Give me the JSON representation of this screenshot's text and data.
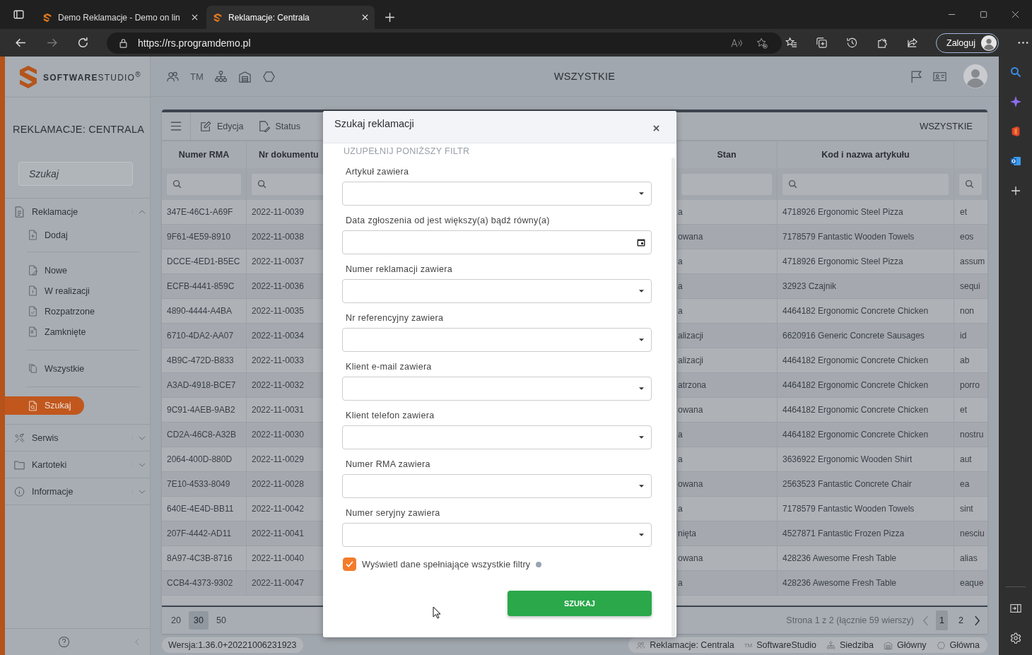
{
  "browser": {
    "tabs": [
      {
        "title": "Demo Reklamacje - Demo on lin",
        "selected": false
      },
      {
        "title": "Reklamacje: Centrala",
        "selected": true
      }
    ],
    "url": "https://rs.programdemo.pl",
    "forward_disabled": true,
    "sign_in": "Zaloguj"
  },
  "header": {
    "logo": "**SOFTWARE**STUDIO$^{®}$",
    "tm": "TM",
    "title": "WSZYSTKIE"
  },
  "sidebar": {
    "title": "REKLAMACJE: CENTRALA",
    "search": {
      "placeholder": "Szukaj"
    },
    "groups": [
      {
        "label": "Reklamacje",
        "expanded": true,
        "sections": [
          {
            "items": [
              {
                "label": "Dodaj",
                "selected": false
              }
            ]
          },
          {
            "items": [
              {
                "label": "Nowe",
                "selected": false
              },
              {
                "label": "W realizacji",
                "selected": false
              },
              {
                "label": "Rozpatrzone",
                "selected": false
              },
              {
                "label": "Zamknięte",
                "selected": false
              }
            ]
          },
          {
            "items": [
              {
                "label": "Wszystkie",
                "selected": false
              }
            ]
          },
          {
            "items": [
              {
                "label": "Szukaj",
                "selected": true
              }
            ]
          }
        ]
      },
      {
        "label": "Serwis",
        "expanded": false
      },
      {
        "label": "Kartoteki",
        "expanded": false
      },
      {
        "label": "Informacje",
        "expanded": false
      }
    ]
  },
  "table": {
    "actions": [
      "Edycja",
      "Status"
    ],
    "view": "WSZYSTKIE",
    "columns": [
      "Numer RMA",
      "Nr dokumentu",
      "Stan",
      "Kod i nazwa artykułu"
    ],
    "rows": [
      {
        "rma": "347E-46C1-A69F",
        "document": "2022-11-0039",
        "status": "a",
        "article": "4718926 Ergonomic Steel Pizza",
        "column_5": "et"
      },
      {
        "rma": "9F61-4E59-8910",
        "document": "2022-11-0038",
        "status": "owana",
        "article": "7178579 Fantastic Wooden Towels",
        "column_5": "eos"
      },
      {
        "rma": "DCCE-4ED1-B5EC",
        "document": "2022-11-0037",
        "status": "a",
        "article": "4718926 Ergonomic Steel Pizza",
        "column_5": "assum"
      },
      {
        "rma": "ECFB-4441-859C",
        "document": "2022-11-0036",
        "status": "a",
        "article": "32923 Czajnik",
        "column_5": "sequi"
      },
      {
        "rma": "4890-4444-A4BA",
        "document": "2022-11-0035",
        "status": "a",
        "article": "4464182 Ergonomic Concrete Chicken",
        "column_5": "non"
      },
      {
        "rma": "6710-4DA2-AA07",
        "document": "2022-11-0034",
        "status": "alizacji",
        "article": "6620916 Generic Concrete Sausages",
        "column_5": "id"
      },
      {
        "rma": "4B9C-472D-B833",
        "document": "2022-11-0033",
        "status": "alizacji",
        "article": "4464182 Ergonomic Concrete Chicken",
        "column_5": "ab"
      },
      {
        "rma": "A3AD-4918-BCE7",
        "document": "2022-11-0032",
        "status": "atrzona",
        "article": "4464182 Ergonomic Concrete Chicken",
        "column_5": "porro"
      },
      {
        "rma": "9C91-4AEB-9AB2",
        "document": "2022-11-0031",
        "status": "owana",
        "article": "4464182 Ergonomic Concrete Chicken",
        "column_5": "et"
      },
      {
        "rma": "CD2A-46C8-A32B",
        "document": "2022-11-0030",
        "status": "a",
        "article": "4464182 Ergonomic Concrete Chicken",
        "column_5": "nostru"
      },
      {
        "rma": "2064-400D-880D",
        "document": "2022-11-0029",
        "status": "a",
        "article": "3636922 Ergonomic Wooden Shirt",
        "column_5": "aut"
      },
      {
        "rma": "7E10-4533-8049",
        "document": "2022-11-0028",
        "status": "owana",
        "article": "2563523 Fantastic Concrete Chair",
        "column_5": "ea"
      },
      {
        "rma": "640E-4E4D-BB11",
        "document": "2022-11-0042",
        "status": "a",
        "article": "7178579 Fantastic Wooden Towels",
        "column_5": "sint"
      },
      {
        "rma": "207F-4442-AD11",
        "document": "2022-11-0041",
        "status": "nięta",
        "article": "4527871 Fantastic Frozen Pizza",
        "column_5": "nesciu"
      },
      {
        "rma": "8A97-4C3B-8716",
        "document": "2022-11-0040",
        "status": "owana",
        "article": "428236 Awesome Fresh Table",
        "column_5": "alias"
      },
      {
        "rma": "CCB4-4373-9302",
        "document": "2022-11-0047",
        "status": "a",
        "article": "428236 Awesome Fresh Table",
        "column_5": "eaque"
      }
    ],
    "page_sizes": [
      {
        "label": "20",
        "selected": false
      },
      {
        "label": "30",
        "selected": true
      },
      {
        "label": "50",
        "selected": false
      }
    ],
    "page_info": "Strona 1 z 2 (łącznie 59 wierszy)",
    "pages": [
      {
        "label": "1",
        "selected": true
      },
      {
        "label": "2",
        "selected": false
      }
    ]
  },
  "status_bar": {
    "version": "Wersja:1.36.0+20221006231923",
    "context": [
      {
        "label": "Reklamacje: Centrala"
      },
      {
        "mark": "TM",
        "label": "SoftwareStudio"
      },
      {
        "label": "Siedziba"
      },
      {
        "label": "Główny"
      },
      {
        "label": "Główna"
      }
    ]
  },
  "dialog": {
    "title": "Szukaj reklamacji",
    "section": "UZUPEŁNIJ PONIŻSZY FILTR",
    "fields": [
      {
        "label": "Artykuł zawiera",
        "kind": "dropdown"
      },
      {
        "label": "Data zgłoszenia od jest większy(a) bądź równy(a)",
        "kind": "date"
      },
      {
        "label": "Numer reklamacji zawiera",
        "kind": "dropdown"
      },
      {
        "label": "Nr referencyjny zawiera",
        "kind": "dropdown"
      },
      {
        "label": "Klient e-mail zawiera",
        "kind": "dropdown"
      },
      {
        "label": "Klient telefon zawiera",
        "kind": "dropdown"
      },
      {
        "label": "Numer RMA zawiera",
        "kind": "dropdown"
      },
      {
        "label": "Numer seryjny zawiera",
        "kind": "dropdown"
      }
    ],
    "match_all": {
      "label": "Wyświetl dane spełniające wszystkie filtry",
      "checked": true
    },
    "submit": "SZUKAJ"
  }
}
